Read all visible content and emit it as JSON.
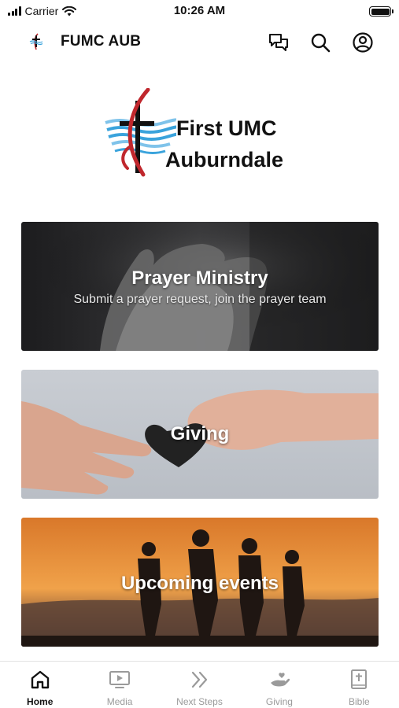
{
  "status_bar": {
    "carrier": "Carrier",
    "time": "10:26 AM",
    "icons": [
      "signal-icon",
      "wifi-icon",
      "battery-icon"
    ]
  },
  "header": {
    "title": "FUMC AUB",
    "icons": [
      "app-logo-icon",
      "chat-icon",
      "search-icon",
      "account-icon"
    ]
  },
  "brand": {
    "line1": "First UMC",
    "line2": "Auburndale"
  },
  "cards": [
    {
      "title": "Prayer Ministry",
      "subtitle": "Submit a prayer request, join the prayer team"
    },
    {
      "title": "Giving",
      "subtitle": ""
    },
    {
      "title": "Upcoming events",
      "subtitle": ""
    }
  ],
  "tabs": [
    {
      "label": "Home",
      "icon": "home-icon",
      "active": true
    },
    {
      "label": "Media",
      "icon": "tv-icon",
      "active": false
    },
    {
      "label": "Next Steps",
      "icon": "double-chevron-icon",
      "active": false
    },
    {
      "label": "Giving",
      "icon": "giving-hand-icon",
      "active": false
    },
    {
      "label": "Bible",
      "icon": "bible-icon",
      "active": false
    }
  ],
  "colors": {
    "active_tab": "#111111",
    "inactive_tab": "#9a9a9a",
    "logo_red": "#c0272d",
    "logo_blue": "#3aa3dc"
  }
}
